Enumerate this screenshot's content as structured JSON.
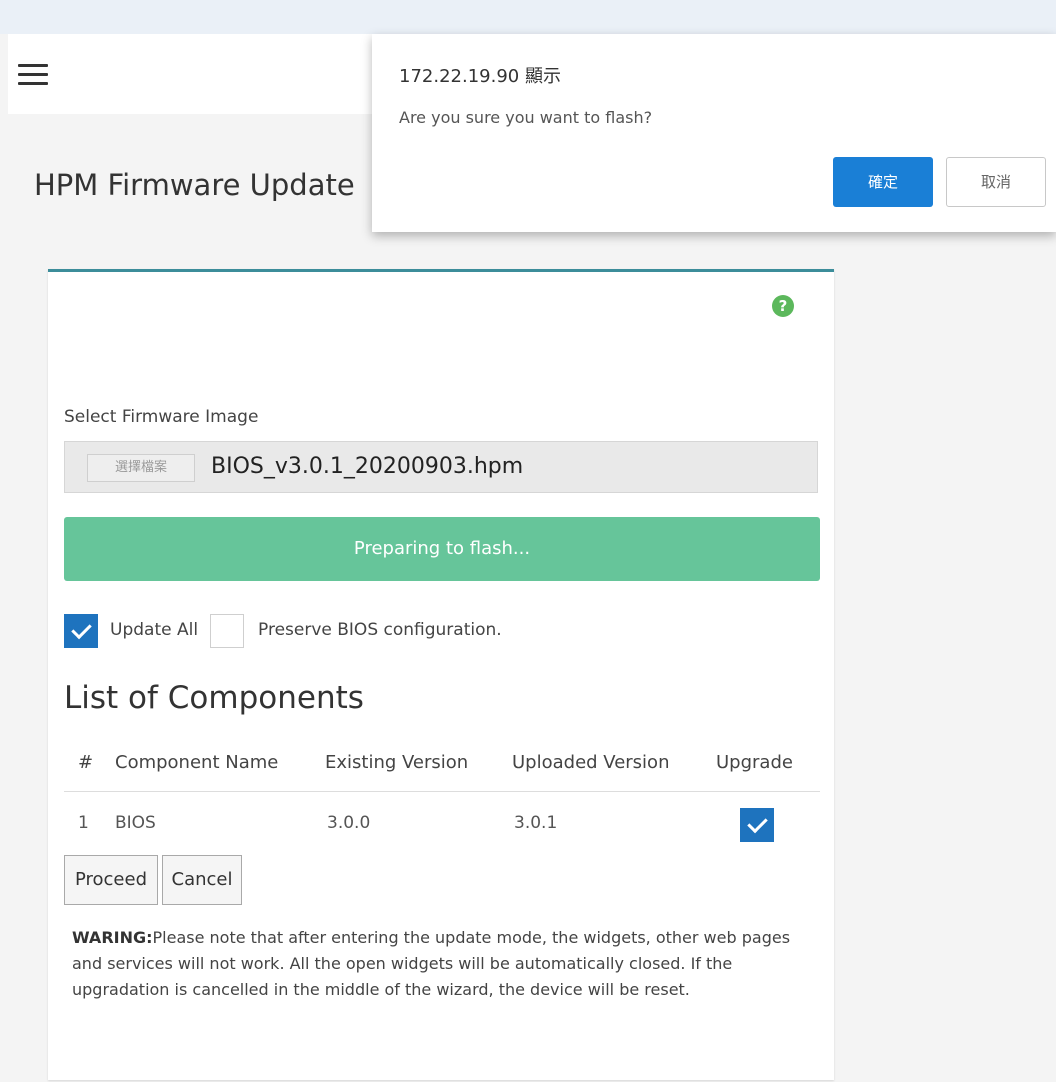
{
  "header": {
    "menu_icon": "hamburger-menu-icon"
  },
  "page": {
    "title": "HPM Firmware Update"
  },
  "panel": {
    "help_icon": "question-circle-icon",
    "help_symbol": "?",
    "select_label": "Select Firmware Image",
    "file_button_label": "選擇檔案",
    "file_name": "BIOS_v3.0.1_20200903.hpm",
    "flash_status": "Preparing to flash...",
    "options": {
      "update_all": {
        "label": "Update All",
        "checked": true
      },
      "preserve_bios": {
        "label": "Preserve BIOS configuration.",
        "checked": false
      }
    },
    "list_title": "List of Components",
    "table": {
      "headers": [
        "#",
        "Component Name",
        "Existing Version",
        "Uploaded Version",
        "Upgrade"
      ],
      "rows": [
        {
          "index": "1",
          "name": "BIOS",
          "existing": "3.0.0",
          "uploaded": "3.0.1",
          "upgrade": true
        }
      ]
    },
    "buttons": {
      "proceed": "Proceed",
      "cancel": "Cancel"
    },
    "warning": {
      "prefix": "WARING:",
      "text": "Please note that after entering the update mode, the widgets, other web pages and services will not work. All the open widgets will be automatically closed. If the upgradation is cancelled in the middle of the wizard, the device will be reset."
    }
  },
  "dialog": {
    "title": "172.22.19.90 顯示",
    "message": "Are you sure you want to flash?",
    "ok_label": "確定",
    "cancel_label": "取消"
  },
  "colors": {
    "accent": "#1e73be",
    "flash_bar": "#66c59a",
    "panel_top_border": "#3c8d9a",
    "help_icon": "#5cb85c",
    "dialog_ok": "#1a7fd6"
  }
}
